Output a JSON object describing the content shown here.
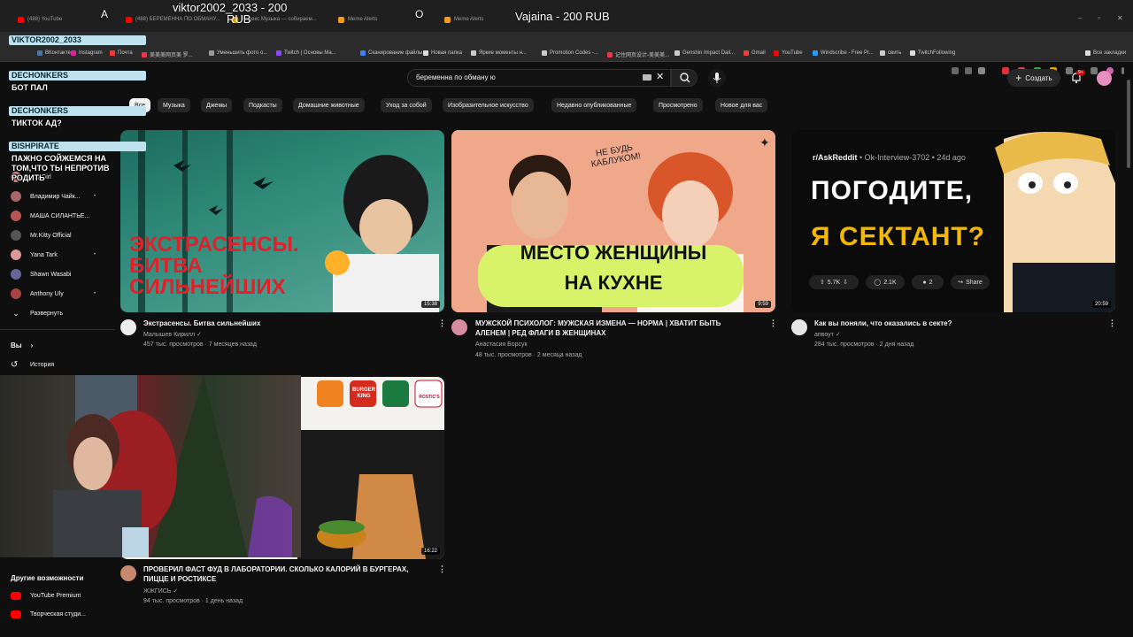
{
  "stream_overlay": {
    "donation_1": "viktor2002_2033 - 200",
    "donation_1_cont": "RUB",
    "donation_2": "Vajaina - 200 RUB",
    "letter_a": "A",
    "letter_o": "O"
  },
  "chat": [
    {
      "name": "VIKTOR2002_2033",
      "msg": ""
    },
    {
      "name": "DECHONKERS",
      "msg": "БОТ ПАЛ"
    },
    {
      "name": "DECHONKERS",
      "msg": "ТИКТОК АД?"
    },
    {
      "name": "BISHPIRATE",
      "msg": "ПАЖНО СОЙЖЕМСЯ НА ТОМ,ЧТО ТЫ НЕПРОТИВ РОДИТЬ"
    }
  ],
  "browser": {
    "tabs": [
      {
        "label": "(488) YouTube",
        "color": "#ff0000"
      },
      {
        "label": "(488) БЕРЕМЕННА ПО ОБМАНУ...",
        "color": "#ff0000"
      },
      {
        "label": "Яндекс Музыка — собираем...",
        "color": "#ffcc00"
      },
      {
        "label": "Meme Alerts",
        "color": "#f59b1f"
      },
      {
        "label": "Meme Alerts",
        "color": "#f59b1f"
      }
    ],
    "bookmarks": [
      {
        "label": "ВКонтакте",
        "color": "#4a76a8"
      },
      {
        "label": "Instagram",
        "color": "#d6249f"
      },
      {
        "label": "Почта",
        "color": "#ff3333"
      },
      {
        "label": "美美美网页美 罗...",
        "color": "#e34"
      },
      {
        "label": "Уменьшить фото о...",
        "color": "#999"
      },
      {
        "label": "Twitch | Основы Ma...",
        "color": "#9146ff"
      },
      {
        "label": "Сканирование файлы",
        "color": "#3b82f6"
      },
      {
        "label": "Новая папка",
        "color": "#ddd"
      },
      {
        "label": "Яркие моменты н...",
        "color": "#ccc"
      },
      {
        "label": "Promotion Codes -...",
        "color": "#ccc"
      },
      {
        "label": "记住网页设计-美美美...",
        "color": "#e34"
      },
      {
        "label": "Genshin Impact Dail...",
        "color": "#ccc"
      },
      {
        "label": "Gmail",
        "color": "#ea4335"
      },
      {
        "label": "YouTube",
        "color": "#ff0000"
      },
      {
        "label": "Windscribe - Free Pr...",
        "color": "#2a9df4"
      },
      {
        "label": "свить",
        "color": "#ccc"
      },
      {
        "label": "TwitchFollowing",
        "color": "#ddd"
      }
    ],
    "all_bookmarks": "Все закладки"
  },
  "youtube": {
    "search_value": "беременна по обману ю",
    "create_label": "Создать",
    "notif_count": "9+",
    "chips": [
      "Все",
      "Музыка",
      "Джемы",
      "Подкасты",
      "Домашние животные",
      "Уход за собой",
      "Изобразительное искусство",
      "Недавно опубликованные",
      "Просмотрено",
      "Новое для вас"
    ],
    "sidebar": {
      "subs": [
        {
          "label": "...ly Girl",
          "color": "#c88"
        },
        {
          "label": "Владимир Чайк...",
          "color": "#a66"
        },
        {
          "label": "МАША СИЛАНТЬЕ...",
          "color": "#b55"
        },
        {
          "label": "Mr.Kitty Official",
          "color": "#555"
        },
        {
          "label": "Yana Tark",
          "color": "#d99"
        },
        {
          "label": "Shawn Wasabi",
          "color": "#669"
        },
        {
          "label": "Anthony Uly",
          "color": "#a44"
        }
      ],
      "expand": "Развернуть",
      "you": "Вы",
      "history": "История",
      "more_title": "Другие возможности",
      "premium": "YouTube Premium",
      "studio": "Творческая студи..."
    },
    "videos": [
      {
        "title": "Экстрасенсы. Битва сильнейших",
        "channel": "Малышев Кирилл",
        "meta": "457 тыс. просмотров · 7 месяцев назад",
        "duration": "15:38",
        "thumb_text": "ЭКСТРАСЕНСЫ. БИТВА СИЛЬНЕЙШИХ"
      },
      {
        "title": "МУЖСКОЙ ПСИХОЛОГ: МУЖСКАЯ ИЗМЕНА — НОРМА | ХВАТИТ БЫТЬ АЛЕНЕМ | РЕД ФЛАГИ В ЖЕНЩИНАХ",
        "channel": "Анастасия Борсук",
        "meta": "48 тыс. просмотров · 2 месяца назад",
        "duration": "9:59",
        "thumb_line1": "МЕСТО ЖЕНЩИНЫ",
        "thumb_line2": "НА КУХНЕ",
        "thumb_hand": "НЕ БУДЬ КАБЛУКОМ!"
      },
      {
        "title": "Как вы поняли, что оказались в секте?",
        "channel": "апвоут",
        "meta": "284 тыс. просмотров · 2 дня назад",
        "duration": "20:59",
        "thumb_sub": "r/AskReddit",
        "thumb_user": "• Ok-Interview-3702 • 24d ago",
        "thumb_line1": "ПОГОДИТЕ,",
        "thumb_line2": "Я СЕКТАНТ?",
        "votes": "5.7K",
        "comments": "2.1K",
        "awards": "2",
        "share": "Share"
      },
      {
        "title": "ПРОВЕРИЛ ФАСТ ФУД В ЛАБОРАТОРИИ. СКОЛЬКО КАЛОРИЙ В БУРГЕРАХ, ПИЦЦЕ И РОСТИКСЕ",
        "channel": "ЖЖГИСЬ",
        "meta": "94 тыс. просмотров · 1 день назад",
        "duration": "16:22",
        "logo1": "BURGER KING",
        "logo2": "ROSTIC'S"
      }
    ]
  }
}
